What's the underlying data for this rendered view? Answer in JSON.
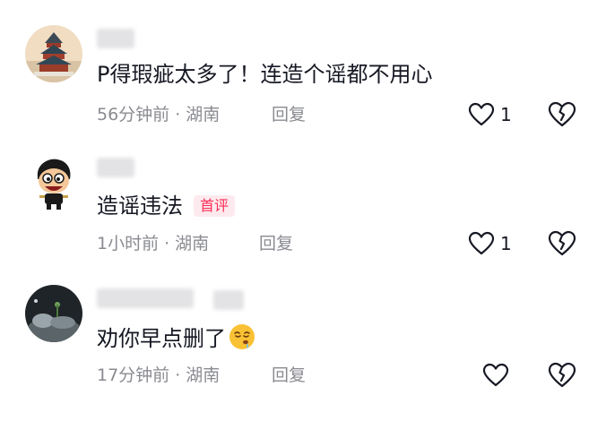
{
  "comments": [
    {
      "text": "P得瑕疵太多了！连造个谣都不用心",
      "time": "56分钟前",
      "separator": "·",
      "location": "湖南",
      "reply_label": "回复",
      "likes": "1",
      "avatar_icon": "temple-of-heaven-avatar"
    },
    {
      "text": "造谣违法",
      "tag": "首评",
      "time": "1小时前",
      "separator": "·",
      "location": "湖南",
      "reply_label": "回复",
      "likes": "1",
      "avatar_icon": "cartoon-character-avatar"
    },
    {
      "text": "劝你早点删了",
      "emoji": "drooling-face-emoji",
      "time": "17分钟前",
      "separator": "·",
      "location": "湖南",
      "reply_label": "回复",
      "likes": "",
      "avatar_icon": "dark-scene-avatar"
    }
  ],
  "icons": {
    "like": "heart-outline-icon",
    "dislike": "broken-heart-icon"
  },
  "colors": {
    "text": "#161823",
    "meta": "#8a8b91",
    "tag": "#fe2c55",
    "tag_bg": "#fdeaee"
  }
}
